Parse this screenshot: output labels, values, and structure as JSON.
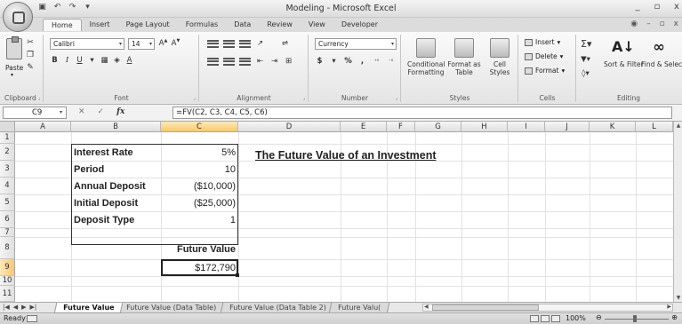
{
  "window": {
    "title": "Modeling - Microsoft Excel",
    "controls": [
      "_",
      "▫",
      "x"
    ]
  },
  "qat_icons": [
    "save-icon",
    "undo-icon",
    "redo-icon",
    "customize-icon"
  ],
  "tabs": [
    "Home",
    "Insert",
    "Page Layout",
    "Formulas",
    "Data",
    "Review",
    "View",
    "Developer"
  ],
  "active_tab": "Home",
  "ribbon": {
    "clipboard": {
      "label": "Clipboard",
      "paste": "Paste"
    },
    "font": {
      "label": "Font",
      "name": "Calibri",
      "size": "14"
    },
    "alignment": {
      "label": "Alignment"
    },
    "number": {
      "label": "Number",
      "format": "Currency",
      "dollar": "$",
      "percent": "%",
      "comma": ","
    },
    "styles": {
      "label": "Styles",
      "conditional": "Conditional Formatting",
      "format_table": "Format as Table",
      "cell_styles": "Cell Styles"
    },
    "cells": {
      "label": "Cells",
      "insert": "Insert",
      "delete": "Delete",
      "format": "Format"
    },
    "editing": {
      "label": "Editing",
      "sort": "Sort & Filter",
      "find": "Find & Select"
    }
  },
  "formula_bar": {
    "name_box": "C9",
    "formula": "=FV(C2, C3, C4, C5, C6)"
  },
  "columns": [
    "A",
    "B",
    "C",
    "D",
    "E",
    "F",
    "G",
    "H",
    "I",
    "J",
    "K",
    "L"
  ],
  "rows": [
    "1",
    "2",
    "3",
    "4",
    "5",
    "6",
    "7",
    "8",
    "9",
    "10",
    "11"
  ],
  "sheet": {
    "title": "The Future Value of an Investment",
    "inputs": [
      {
        "label": "Interest Rate",
        "value": "5%"
      },
      {
        "label": "Period",
        "value": "10"
      },
      {
        "label": "Annual Deposit",
        "value": "($10,000)"
      },
      {
        "label": "Initial Deposit",
        "value": "($25,000)"
      },
      {
        "label": "Deposit Type",
        "value": "1"
      }
    ],
    "result_label": "Future Value",
    "result_value": "$172,790"
  },
  "sheet_tabs": [
    "Future Value",
    "Future Value (Data Table)",
    "Future Value (Data Table 2)",
    "Future Valu("
  ],
  "active_sheet": "Future Value",
  "status": {
    "text": "Ready",
    "zoom": "100%"
  }
}
